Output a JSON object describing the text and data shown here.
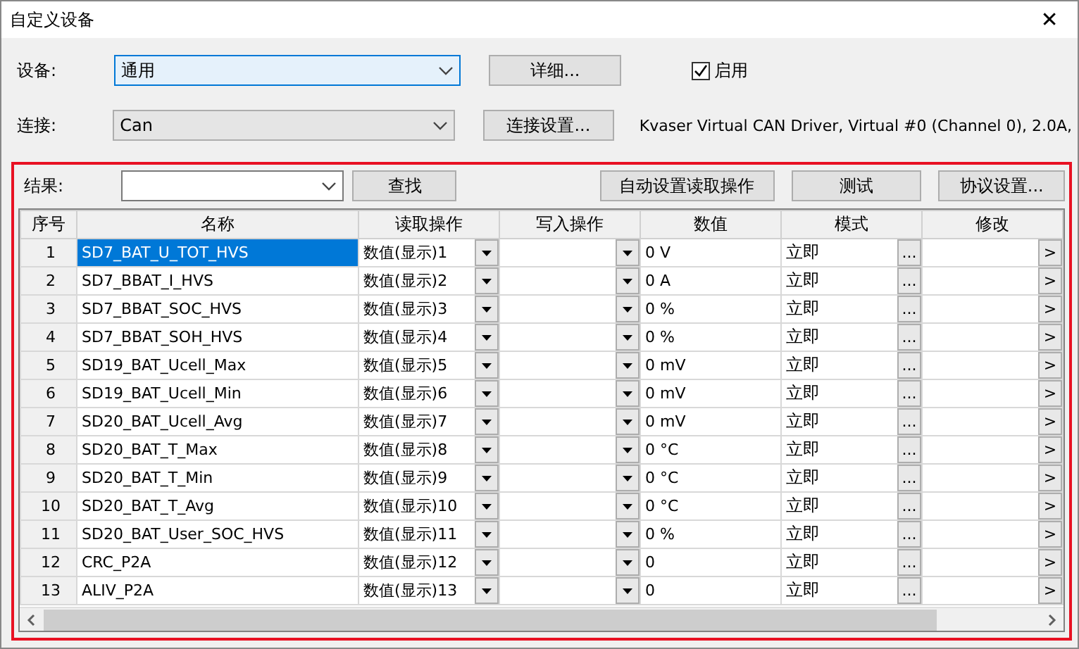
{
  "window": {
    "title": "自定义设备",
    "close": "✕"
  },
  "device": {
    "label": "设备:",
    "value": "通用",
    "details_button": "详细...",
    "enable": {
      "label": "启用",
      "checked": true
    }
  },
  "connection": {
    "label": "连接:",
    "value": "Can",
    "settings_button": "连接设置...",
    "info": "Kvaser Virtual CAN Driver, Virtual #0 (Channel 0), 2.0A,"
  },
  "result": {
    "label": "结果:",
    "find_button": "查找",
    "auto_button": "自动设置读取操作",
    "test_button": "测试",
    "protocol_button": "协议设置..."
  },
  "table": {
    "columns": [
      "序号",
      "名称",
      "读取操作",
      "写入操作",
      "数值",
      "模式",
      "修改"
    ],
    "rows": [
      {
        "no": "1",
        "name": "SD7_BAT_U_TOT_HVS",
        "read": "数值(显示)1",
        "value": "0 V",
        "mode": "立即",
        "selected": true
      },
      {
        "no": "2",
        "name": "SD7_BBAT_I_HVS",
        "read": "数值(显示)2",
        "value": "0 A",
        "mode": "立即",
        "selected": false
      },
      {
        "no": "3",
        "name": "SD7_BBAT_SOC_HVS",
        "read": "数值(显示)3",
        "value": "0 %",
        "mode": "立即",
        "selected": false
      },
      {
        "no": "4",
        "name": "SD7_BBAT_SOH_HVS",
        "read": "数值(显示)4",
        "value": "0 %",
        "mode": "立即",
        "selected": false
      },
      {
        "no": "5",
        "name": "SD19_BAT_Ucell_Max",
        "read": "数值(显示)5",
        "value": "0 mV",
        "mode": "立即",
        "selected": false
      },
      {
        "no": "6",
        "name": "SD19_BAT_Ucell_Min",
        "read": "数值(显示)6",
        "value": "0 mV",
        "mode": "立即",
        "selected": false
      },
      {
        "no": "7",
        "name": "SD20_BAT_Ucell_Avg",
        "read": "数值(显示)7",
        "value": "0 mV",
        "mode": "立即",
        "selected": false
      },
      {
        "no": "8",
        "name": "SD20_BAT_T_Max",
        "read": "数值(显示)8",
        "value": "0 °C",
        "mode": "立即",
        "selected": false
      },
      {
        "no": "9",
        "name": "SD20_BAT_T_Min",
        "read": "数值(显示)9",
        "value": "0 °C",
        "mode": "立即",
        "selected": false
      },
      {
        "no": "10",
        "name": "SD20_BAT_T_Avg",
        "read": "数值(显示)10",
        "value": "0 °C",
        "mode": "立即",
        "selected": false
      },
      {
        "no": "11",
        "name": "SD20_BAT_User_SOC_HVS",
        "read": "数值(显示)11",
        "value": "0 %",
        "mode": "立即",
        "selected": false
      },
      {
        "no": "12",
        "name": "CRC_P2A",
        "read": "数值(显示)12",
        "value": "0",
        "mode": "立即",
        "selected": false
      },
      {
        "no": "13",
        "name": "ALIV_P2A",
        "read": "数值(显示)13",
        "value": "0",
        "mode": "立即",
        "selected": false
      }
    ],
    "mode_button": "...",
    "edit_button": ">"
  }
}
